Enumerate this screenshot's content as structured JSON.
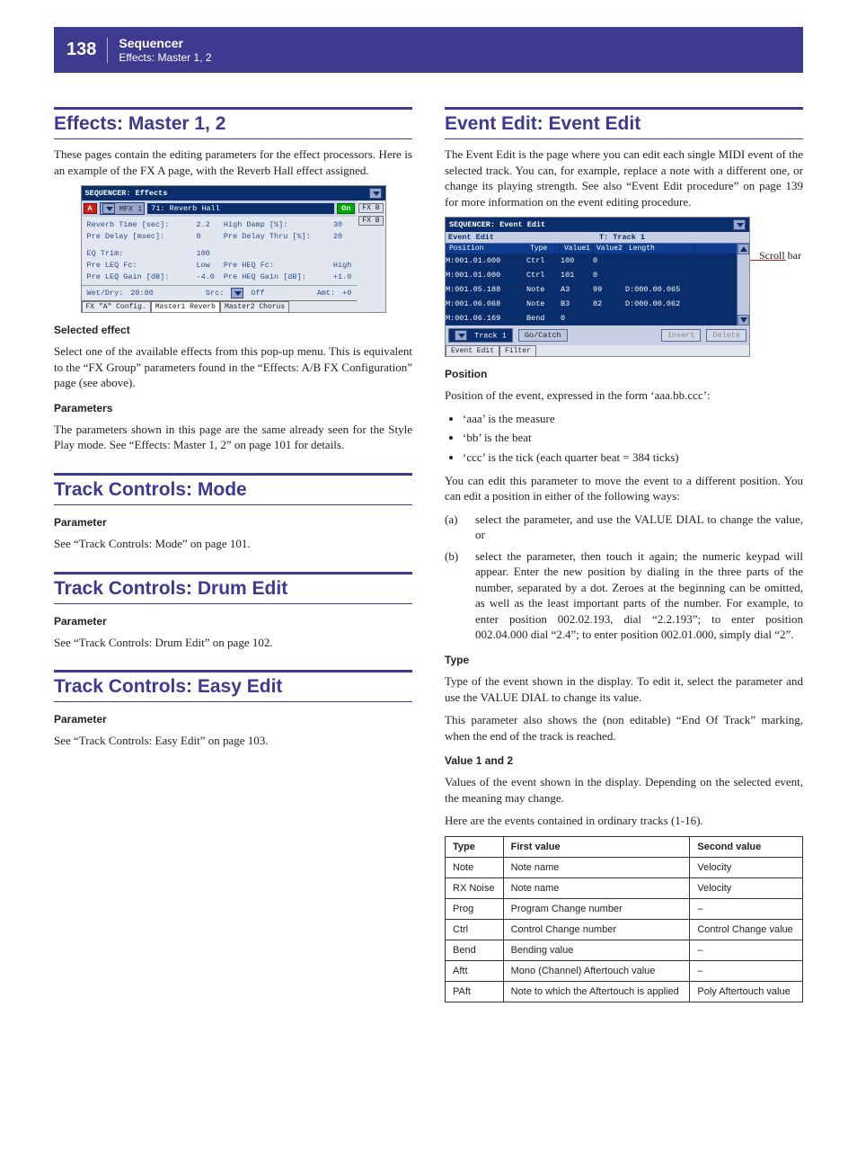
{
  "header": {
    "page_number": "138",
    "title": "Sequencer",
    "subtitle": "Effects: Master 1, 2"
  },
  "left": {
    "sec1": {
      "title": "Effects: Master 1, 2",
      "intro": "These pages contain the editing parameters for the effect processors. Here is an example of the FX A page, with the Reverb Hall effect assigned.",
      "fx_screenshot": {
        "titlebar": "SEQUENCER: Effects",
        "group_badge": "A",
        "mfx_select": "MFX 1",
        "effect_name": "71: Reverb Hall",
        "on_label": "On",
        "side_tabs": [
          "FX B",
          "FX B"
        ],
        "params": [
          {
            "l1": "Reverb Time [sec]:",
            "v1": "2.2",
            "l2": "High Damp [%]:",
            "v2": "30"
          },
          {
            "l1": "Pre Delay [msec]:",
            "v1": "0",
            "l2": "Pre Delay Thru [%]:",
            "v2": "20"
          },
          {
            "l1": "EQ Trim:",
            "v1": "100",
            "l2": "",
            "v2": ""
          },
          {
            "l1": "Pre LEQ Fc:",
            "v1": "Low",
            "l2": "Pre HEQ Fc:",
            "v2": "High"
          },
          {
            "l1": "Pre LEQ Gain [dB]:",
            "v1": "-4.0",
            "l2": "Pre HEQ Gain [dB]:",
            "v2": "+1.0"
          }
        ],
        "wetdry": {
          "label": "Wet/Dry:",
          "value": "20:80",
          "src_label": "Src:",
          "src_value": "Off",
          "amt_label": "Amt:",
          "amt_value": "+0"
        },
        "bottom_tabs": [
          "FX \"A\" Config.",
          "Master1 Reverb",
          "Master2 Chorus"
        ]
      },
      "selected_heading": "Selected effect",
      "selected_text": "Select one of the available effects from this pop-up menu. This is equivalent to the “FX Group” parameters found in the “Effects: A/B FX Configuration” page (see above).",
      "params_heading": "Parameters",
      "params_text": "The parameters shown in this page are the same already seen for the Style Play mode. See “Effects: Master 1, 2” on page 101 for details."
    },
    "sec2": {
      "title": "Track Controls: Mode",
      "param_heading": "Parameter",
      "param_text": "See “Track Controls: Mode” on page 101."
    },
    "sec3": {
      "title": "Track Controls: Drum Edit",
      "param_heading": "Parameter",
      "param_text": "See “Track Controls: Drum Edit” on page 102."
    },
    "sec4": {
      "title": "Track Controls: Easy Edit",
      "param_heading": "Parameter",
      "param_text": "See “Track Controls: Easy Edit” on page 103."
    }
  },
  "right": {
    "sec": {
      "title": "Event Edit: Event Edit",
      "intro": "The Event Edit is the page where you can edit each single MIDI event of the selected track. You can, for example, replace a note with a different one, or change its playing strength. See also “Event Edit procedure” on page 139 for more information on the event editing procedure.",
      "annot": "Scroll bar",
      "screenshot": {
        "titlebar": "SEQUENCER: Event Edit",
        "headrow": {
          "label": "Event Edit",
          "track": "T: Track 1"
        },
        "cols": [
          "Position",
          "Type",
          "Value1",
          "Value2",
          "Length"
        ],
        "rows": [
          {
            "pos": "M:001.01.000",
            "type": "Ctrl",
            "v1": "100",
            "v2": "0",
            "len": ""
          },
          {
            "pos": "M:001.01.000",
            "type": "Ctrl",
            "v1": "101",
            "v2": "0",
            "len": ""
          },
          {
            "pos": "M:001.05.188",
            "type": "Note",
            "v1": "A3",
            "v2": "99",
            "len": "D:000.00.065"
          },
          {
            "pos": "M:001.06.068",
            "type": "Note",
            "v1": "B3",
            "v2": "82",
            "len": "D:000.00.062"
          },
          {
            "pos": "M:001.06.169",
            "type": "Bend",
            "v1": "0",
            "v2": "",
            "len": ""
          }
        ],
        "toolbar": {
          "track_btn": "Track 1",
          "gocatch": "Go/Catch",
          "insert": "Insert",
          "delete": "Delete"
        },
        "tabs": [
          "Event Edit",
          "Filter"
        ]
      },
      "position_heading": "Position",
      "position_intro": "Position of the event, expressed in the form ‘aaa.bb.ccc’:",
      "position_bullets": [
        "‘aaa’ is the measure",
        "‘bb’ is the beat",
        "‘ccc’ is the tick (each quarter beat = 384 ticks)"
      ],
      "position_after": "You can edit this parameter to move the event to a different position. You can edit a position in either of the following ways:",
      "alpha": [
        {
          "label": "(a)",
          "text": "select the parameter, and use the VALUE DIAL to change the value, or"
        },
        {
          "label": "(b)",
          "text": "select the parameter, then touch it again; the numeric keypad will appear. Enter the new position by dialing in the three parts of the number, separated by a dot. Zeroes at the beginning can be omitted, as well as the least important parts of the number. For example, to enter position 002.02.193, dial “2.2.193”; to enter position 002.04.000 dial “2.4”; to enter position 002.01.000, simply dial “2”."
        }
      ],
      "type_heading": "Type",
      "type_text1": "Type of the event shown in the display. To edit it, select the parameter and use the VALUE DIAL to change its value.",
      "type_text2": "This parameter also shows the (non editable) “End Of Track” marking, when the end of the track is reached.",
      "val_heading": "Value 1 and 2",
      "val_text1": "Values of the event shown in the display. Depending on the selected event, the meaning may change.",
      "val_text2": "Here are the events contained in ordinary tracks (1-16).",
      "table": {
        "head": [
          "Type",
          "First value",
          "Second value"
        ],
        "rows": [
          [
            "Note",
            "Note name",
            "Velocity"
          ],
          [
            "RX Noise",
            "Note name",
            "Velocity"
          ],
          [
            "Prog",
            "Program Change number",
            "–"
          ],
          [
            "Ctrl",
            "Control Change number",
            "Control Change value"
          ],
          [
            "Bend",
            "Bending value",
            "–"
          ],
          [
            "Aftt",
            "Mono (Channel) Aftertouch value",
            "–"
          ],
          [
            "PAft",
            "Note to which the Aftertouch is applied",
            "Poly Aftertouch value"
          ]
        ]
      }
    }
  }
}
